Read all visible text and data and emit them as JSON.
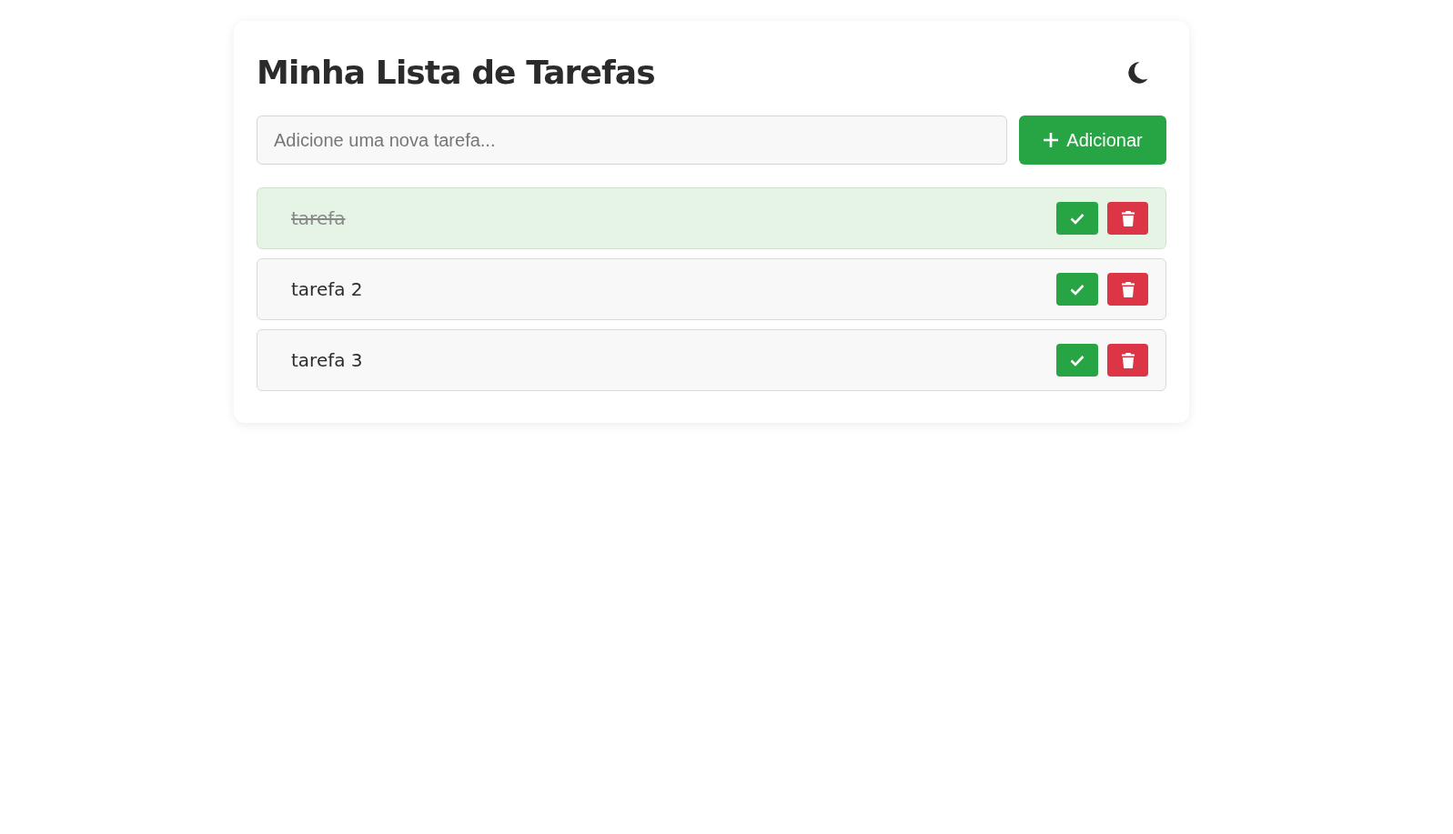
{
  "title": "Minha Lista de Tarefas",
  "new_task": {
    "placeholder": "Adicione uma nova tarefa..."
  },
  "add_button": {
    "label": "Adicionar"
  },
  "tasks": [
    {
      "text": "tarefa",
      "completed": true
    },
    {
      "text": "tarefa 2",
      "completed": false
    },
    {
      "text": "tarefa 3",
      "completed": false
    }
  ]
}
